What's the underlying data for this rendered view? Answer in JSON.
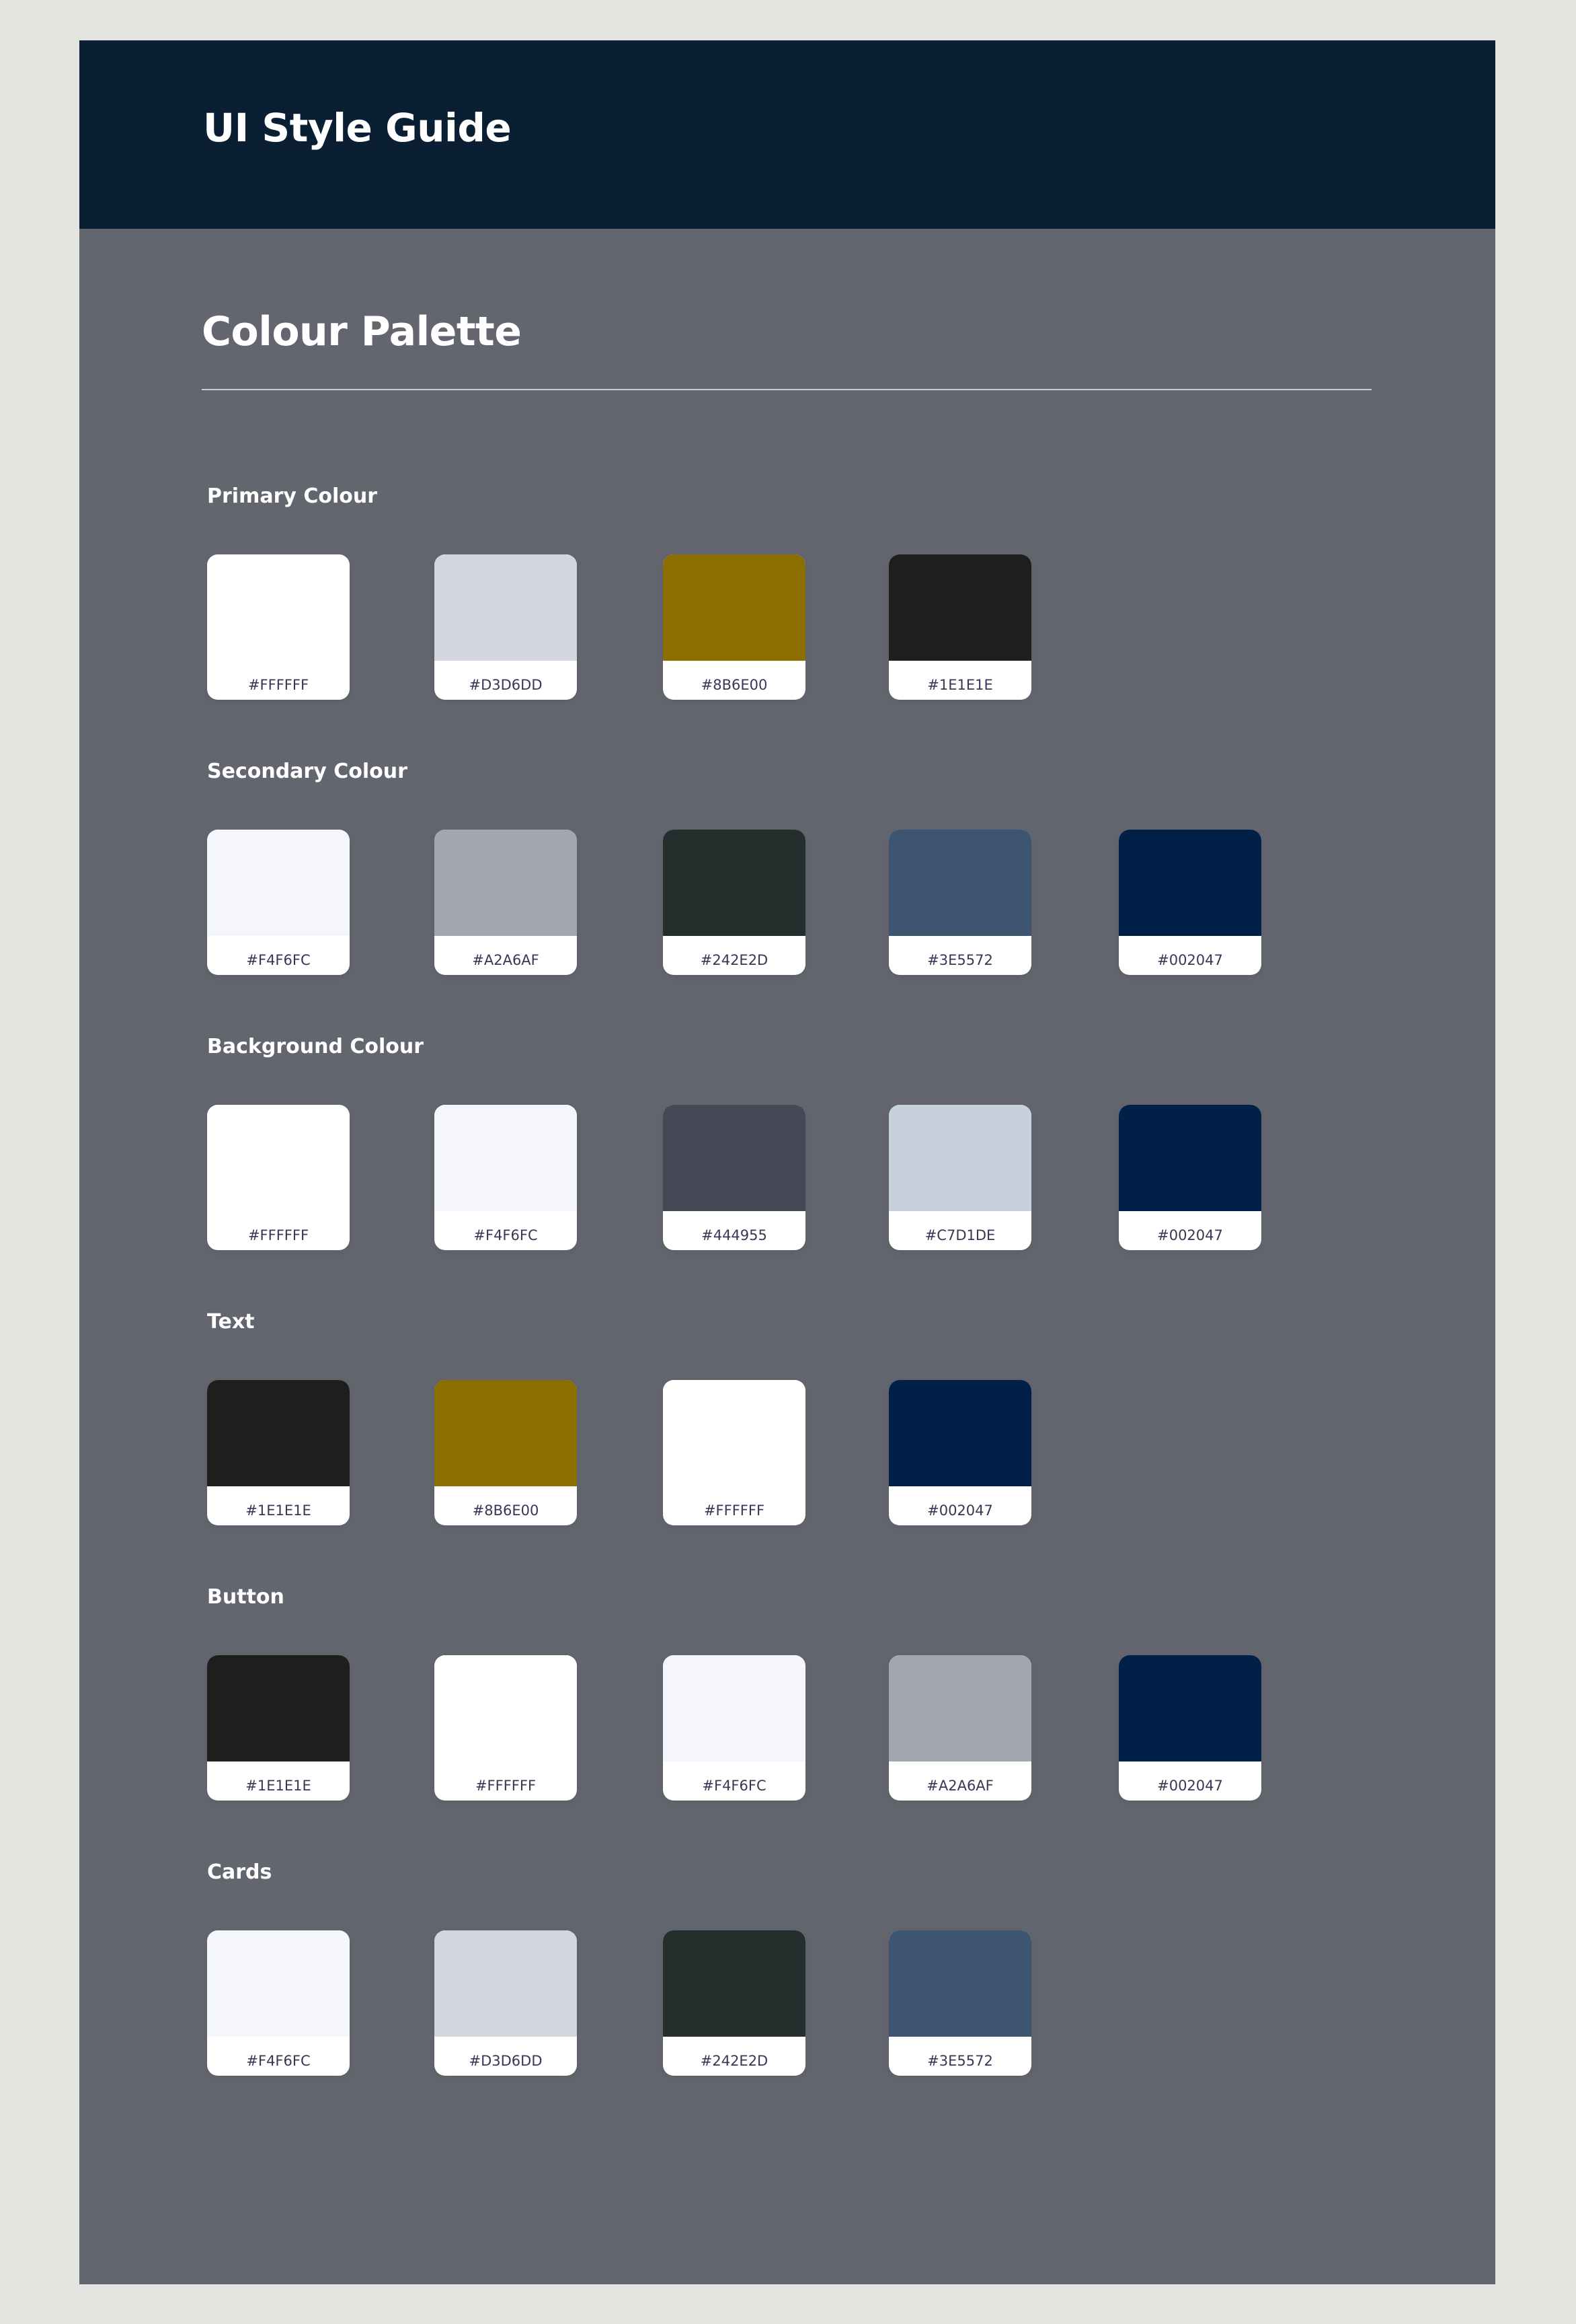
{
  "header": {
    "title": "UI Style Guide"
  },
  "section": {
    "title": "Colour Palette"
  },
  "groups": [
    {
      "label": "Primary Colour",
      "swatches": [
        "#FFFFFF",
        "#D3D6DD",
        "#8B6E00",
        "#1E1E1E"
      ]
    },
    {
      "label": "Secondary Colour",
      "swatches": [
        "#F4F6FC",
        "#A2A6AF",
        "#242E2D",
        "#3E5572",
        "#002047"
      ]
    },
    {
      "label": "Background Colour",
      "swatches": [
        "#FFFFFF",
        "#F4F6FC",
        "#444955",
        "#C7D1DE",
        "#002047"
      ]
    },
    {
      "label": "Text",
      "swatches": [
        "#1E1E1E",
        "#8B6E00",
        "#FFFFFF",
        "#002047"
      ]
    },
    {
      "label": "Button",
      "swatches": [
        "#1E1E1E",
        "#FFFFFF",
        "#F4F6FC",
        "#A2A6AF",
        "#002047"
      ]
    },
    {
      "label": "Cards",
      "swatches": [
        "#F4F6FC",
        "#D3D6DD",
        "#242E2D",
        "#3E5572"
      ]
    }
  ]
}
